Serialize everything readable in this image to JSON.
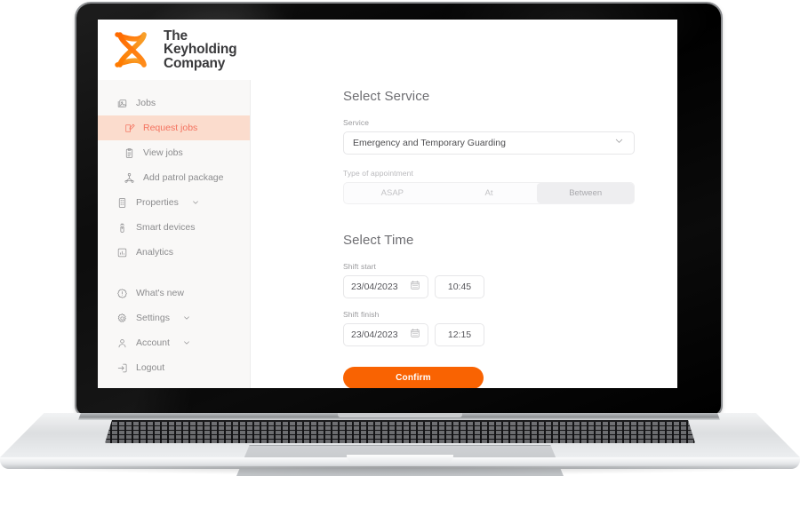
{
  "brand": {
    "logo_icon": "keyholding-x-logo",
    "name_line1": "The",
    "name_line2": "Keyholding",
    "name_line3": "Company",
    "logo_color_start": "#ff7a00",
    "logo_color_end": "#f5a623"
  },
  "colors": {
    "accent_orange": "#f96302",
    "active_item_bg": "#fbdccd",
    "active_item_fg": "#f4725f",
    "sidebar_bg": "#f9f8f7",
    "text_muted": "#8c8c8e"
  },
  "sidebar": {
    "items": [
      {
        "label": "Jobs",
        "icon": "jobs-icon",
        "active": false,
        "sub": false,
        "chevron": false
      },
      {
        "label": "Request jobs",
        "icon": "edit-square-icon",
        "active": true,
        "sub": true,
        "chevron": false
      },
      {
        "label": "View jobs",
        "icon": "clipboard-icon",
        "active": false,
        "sub": true,
        "chevron": false
      },
      {
        "label": "Add patrol package",
        "icon": "patrol-route-icon",
        "active": false,
        "sub": true,
        "chevron": false
      },
      {
        "label": "Properties",
        "icon": "building-icon",
        "active": false,
        "sub": false,
        "chevron": true
      },
      {
        "label": "Smart devices",
        "icon": "smart-device-icon",
        "active": false,
        "sub": false,
        "chevron": false
      },
      {
        "label": "Analytics",
        "icon": "bar-chart-icon",
        "active": false,
        "sub": false,
        "chevron": false
      }
    ],
    "footer_items": [
      {
        "label": "What's new",
        "icon": "info-badge-icon",
        "chevron": false
      },
      {
        "label": "Settings",
        "icon": "gear-icon",
        "chevron": true
      },
      {
        "label": "Account",
        "icon": "person-icon",
        "chevron": true
      },
      {
        "label": "Logout",
        "icon": "logout-icon",
        "chevron": false
      }
    ]
  },
  "main": {
    "select_service": {
      "title": "Select Service",
      "service_label": "Service",
      "service_value": "Emergency and Temporary Guarding",
      "service_chevron_icon": "chevron-down-icon",
      "appointment_label": "Type of appointment",
      "appointment_options": [
        {
          "label": "ASAP",
          "selected": false
        },
        {
          "label": "At",
          "selected": false
        },
        {
          "label": "Between",
          "selected": true
        }
      ]
    },
    "select_time": {
      "title": "Select Time",
      "shift_start_label": "Shift start",
      "shift_start_date": "23/04/2023",
      "shift_start_time": "10:45",
      "shift_finish_label": "Shift finish",
      "shift_finish_date": "23/04/2023",
      "shift_finish_time": "12:15",
      "calendar_icon": "calendar-icon"
    },
    "confirm_label": "Confirm"
  }
}
